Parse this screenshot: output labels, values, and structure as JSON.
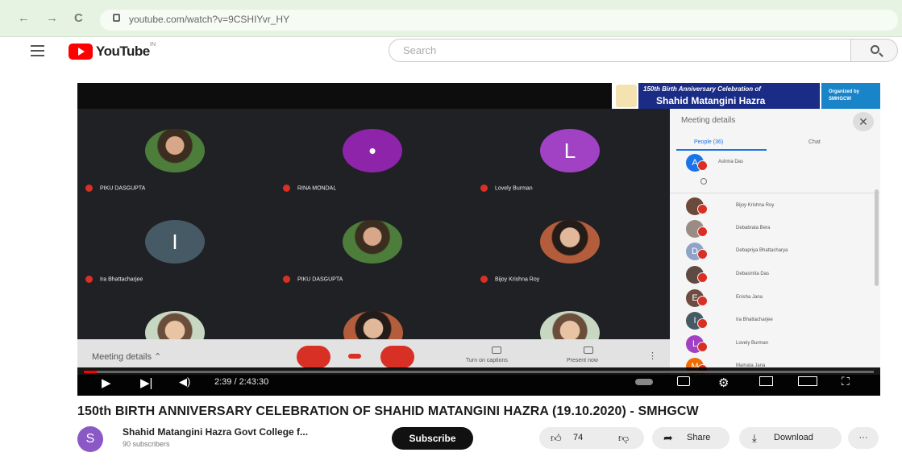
{
  "browser": {
    "back": "←",
    "forward": "→",
    "reload": "C",
    "url": "youtube.com/watch?v=9CSHIYvr_HY"
  },
  "header": {
    "logo_text": "YouTube",
    "country": "IN",
    "search_placeholder": "Search"
  },
  "banner": {
    "line1": "150th Birth Anniversary Celebration of",
    "line2": "Shahid Matangini Hazra",
    "org1": "Organized by",
    "org2": "SMHGCW"
  },
  "meeting": {
    "tiles": [
      {
        "name": "PIKU DASGUPTA",
        "kind": "photo",
        "letter": ""
      },
      {
        "name": "RINA MONDAL",
        "kind": "letter",
        "letter": "•",
        "color": "#8e24aa"
      },
      {
        "name": "Lovely Burman",
        "kind": "letter",
        "letter": "L",
        "color": "#a142c5"
      },
      {
        "name": "Ira Bhattacharjee",
        "kind": "letter",
        "letter": "I",
        "color": "#455a64"
      },
      {
        "name": "PIKU DASGUPTA",
        "kind": "photo",
        "letter": ""
      },
      {
        "name": "Bijoy Krishna Roy",
        "kind": "photo2",
        "letter": ""
      }
    ],
    "bottom_label": "Meeting details",
    "captions_label": "Turn on captions",
    "present_label": "Present now",
    "more": "⋮"
  },
  "panel": {
    "title": "Meeting details",
    "close": "✕",
    "tab_people": "People (36)",
    "tab_chat": "Chat",
    "participants": [
      {
        "name": "Ashma Das",
        "letter": "A",
        "color": "#1a73e8"
      },
      {
        "name": "Bijoy Krishna Roy",
        "letter": "",
        "color": "#6b4a3a"
      },
      {
        "name": "Debabrata Bera",
        "letter": "",
        "color": "#9a8b84"
      },
      {
        "name": "Debapriya Bhattacharya",
        "letter": "D",
        "color": "#8fa3c9"
      },
      {
        "name": "Debasmita Das",
        "letter": "",
        "color": "#5d4a40"
      },
      {
        "name": "Enisha Jana",
        "letter": "E",
        "color": "#6d4c41"
      },
      {
        "name": "Ira Bhattacharjee",
        "letter": "I",
        "color": "#455a64"
      },
      {
        "name": "Lovely Burman",
        "letter": "L",
        "color": "#a142c5"
      },
      {
        "name": "Mamata Jana",
        "letter": "M",
        "color": "#ef6c00"
      }
    ]
  },
  "player": {
    "time": "2:39 / 2:43:30",
    "progress": 0.016
  },
  "video": {
    "title": "150th BIRTH ANNIVERSARY CELEBRATION OF SHAHID MATANGINI HAZRA (19.10.2020) - SMHGCW",
    "channel_initial": "S",
    "channel": "Shahid Matangini Hazra Govt College f...",
    "subscribers": "90 subscribers",
    "subscribe": "Subscribe",
    "likes": "74",
    "share": "Share",
    "download": "Download",
    "more": "···"
  }
}
